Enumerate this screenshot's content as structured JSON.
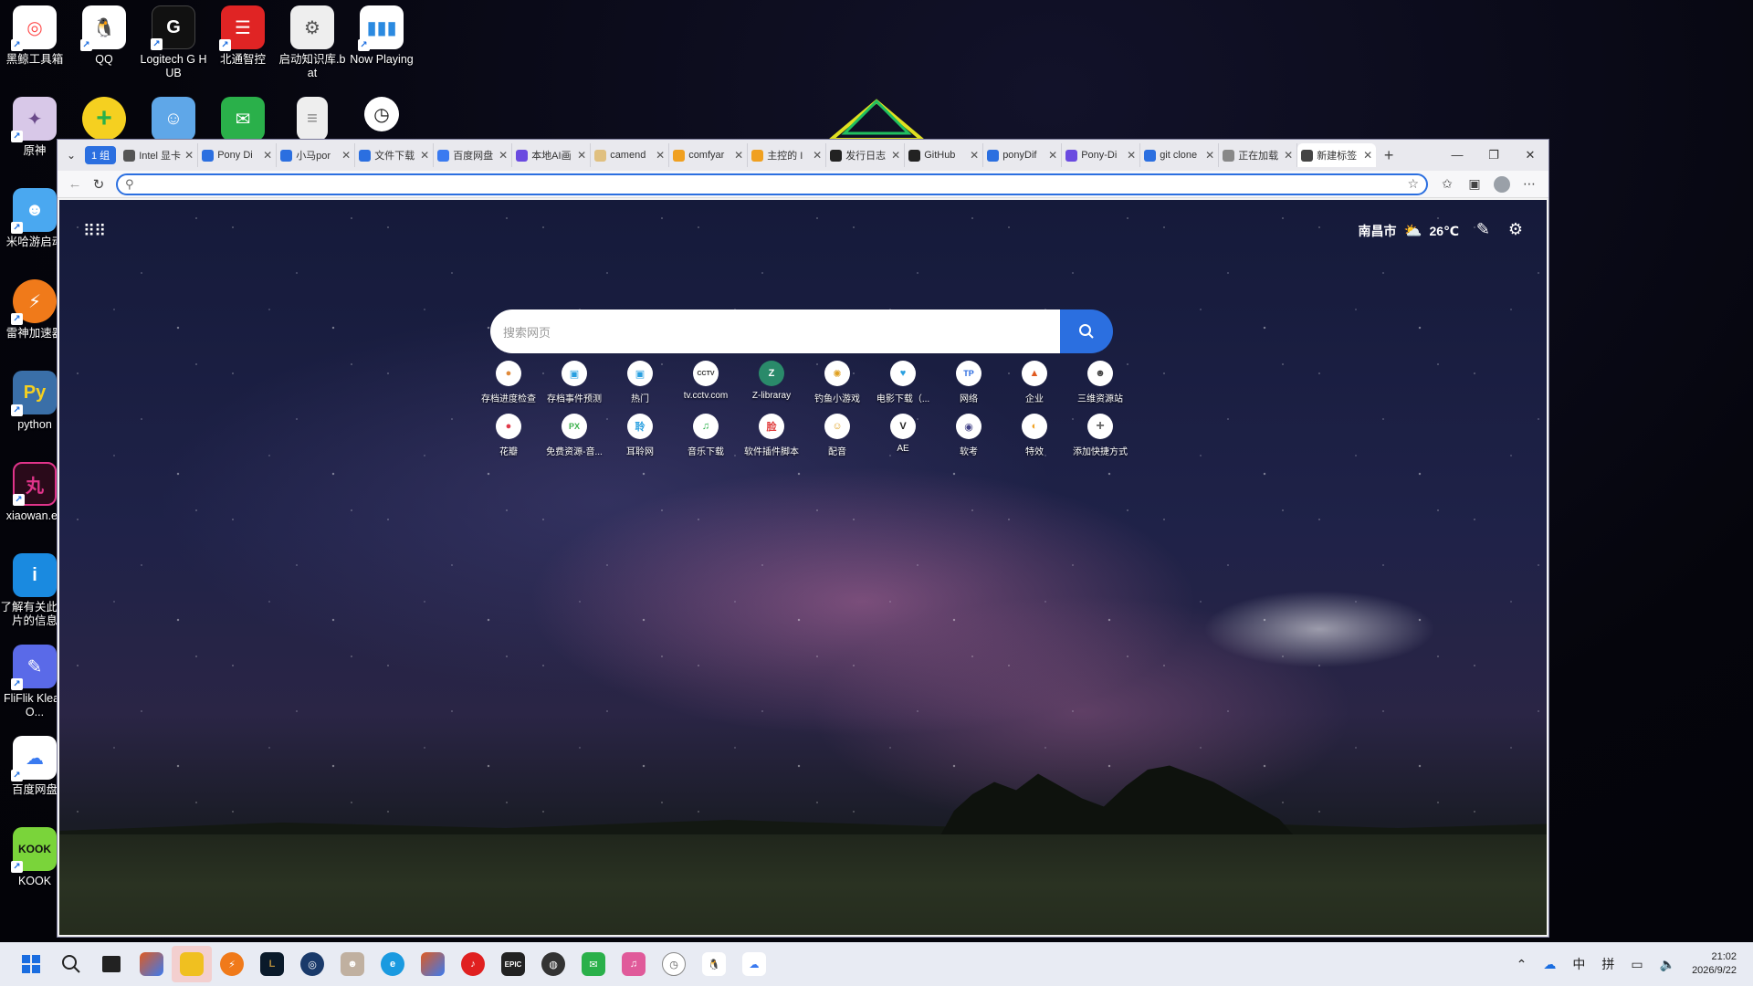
{
  "desktop": {
    "icons_top": [
      {
        "label": "黑鲸工具箱",
        "icon": "heijing-icon",
        "color": "#ff4d4d"
      },
      {
        "label": "QQ",
        "icon": "qq-icon",
        "color": "#ffffff"
      },
      {
        "label": "Logitech G HUB",
        "icon": "logitech-g-icon",
        "color": "#111111"
      },
      {
        "label": "北通智控",
        "icon": "beitong-icon",
        "color": "#e02424"
      },
      {
        "label": "启动知识库.bat",
        "icon": "bat-file-icon",
        "color": "#eeeeee"
      },
      {
        "label": "Now Playing",
        "icon": "now-playing-icon",
        "color": "#ffffff"
      }
    ],
    "icons_second_row": [
      {
        "icon": "plus-green-icon",
        "color": "#2ab04a"
      },
      {
        "icon": "chat-blue-icon",
        "color": "#5fa7e8"
      },
      {
        "icon": "wechat-icon",
        "color": "#2ab04a"
      },
      {
        "icon": "document-icon",
        "color": "#eeeeee"
      },
      {
        "icon": "clock-icon",
        "color": "#ffffff"
      }
    ],
    "icons_left": [
      {
        "label": "原神",
        "icon": "genshin-icon",
        "color": "#d8c8e8"
      },
      {
        "label": "米哈游启动",
        "icon": "mihoyo-launcher-icon",
        "color": "#4aa8f0"
      },
      {
        "label": "雷神加速器",
        "icon": "leishen-icon",
        "color": "#f07a1a"
      },
      {
        "label": "python",
        "icon": "python-icon",
        "color": "#3a6fa8"
      },
      {
        "label": "xiaowan.ex",
        "icon": "xiaowan-icon",
        "color": "#e0348a"
      },
      {
        "label": "了解有关此图片的信息",
        "icon": "spotlight-info-icon",
        "color": "#1a8ae0"
      },
      {
        "label": "FliFlik KleanO...",
        "icon": "fliflik-icon",
        "color": "#5a6ae8"
      },
      {
        "label": "百度网盘",
        "icon": "baidu-netdisk-icon",
        "color": "#ffffff"
      },
      {
        "label": "KOOK",
        "icon": "kook-icon",
        "color": "#7ad43a"
      }
    ]
  },
  "browser": {
    "tab_group_label": "1 组",
    "tabs": [
      {
        "title": "Intel 显卡",
        "icon": "page-icon",
        "color": "#555555"
      },
      {
        "title": "Pony Di",
        "icon": "edge-icon",
        "color": "#2b6fe0"
      },
      {
        "title": "小马por",
        "icon": "edge-icon",
        "color": "#2b6fe0"
      },
      {
        "title": "文件下载",
        "icon": "edge-icon",
        "color": "#2b6fe0"
      },
      {
        "title": "百度网盘",
        "icon": "baidu-icon",
        "color": "#3a7af0"
      },
      {
        "title": "本地AI画",
        "icon": "ai-icon",
        "color": "#6a4ae0"
      },
      {
        "title": "camend",
        "icon": "page-icon",
        "color": "#e0c080"
      },
      {
        "title": "comfyar",
        "icon": "page-icon",
        "color": "#f0a020"
      },
      {
        "title": "主控的 I",
        "icon": "page-icon",
        "color": "#f0a020"
      },
      {
        "title": "发行日志",
        "icon": "github-icon",
        "color": "#222222"
      },
      {
        "title": "GitHub",
        "icon": "github-icon",
        "color": "#222222"
      },
      {
        "title": "ponyDif",
        "icon": "search-icon",
        "color": "#2b6fe0"
      },
      {
        "title": "Pony-Di",
        "icon": "page-icon",
        "color": "#6a4ae0"
      },
      {
        "title": "git clone",
        "icon": "search-icon",
        "color": "#2b6fe0"
      },
      {
        "title": "正在加载",
        "icon": "loading-icon",
        "color": "#888888"
      },
      {
        "title": "新建标签",
        "icon": "newtab-icon",
        "color": "#444444"
      }
    ],
    "url_placeholder": ""
  },
  "ntp": {
    "location": "南昌市",
    "temperature": "26℃",
    "search_placeholder": "搜索网页",
    "shortcuts_row1": [
      {
        "label": "存档进度检查",
        "color": "#e08a3a"
      },
      {
        "label": "存档事件预测",
        "color": "#2aa0e0"
      },
      {
        "label": "热门",
        "color": "#2aa0e0"
      },
      {
        "label": "tv.cctv.com",
        "color": "#333333"
      },
      {
        "label": "Z-libraray",
        "color": "#2a8a6a"
      },
      {
        "label": "钓鱼小游戏",
        "color": "#e0a020"
      },
      {
        "label": "电影下载（...",
        "color": "#2aa0e0"
      },
      {
        "label": "网络",
        "color": "#2a6ae0"
      },
      {
        "label": "企业",
        "color": "#e05a20"
      },
      {
        "label": "三维资源站",
        "color": "#444444"
      }
    ],
    "shortcuts_row2": [
      {
        "label": "花瓣",
        "color": "#e03a4a"
      },
      {
        "label": "免费资源-音...",
        "color": "#3ab04a"
      },
      {
        "label": "耳聆网",
        "color": "#2aa0e0"
      },
      {
        "label": "音乐下载",
        "color": "#2ab04a"
      },
      {
        "label": "软件插件脚本",
        "color": "#e03a3a"
      },
      {
        "label": "配音",
        "color": "#e0a020"
      },
      {
        "label": "AE",
        "color": "#222222"
      },
      {
        "label": "软考",
        "color": "#444488"
      },
      {
        "label": "特效",
        "color": "#f0a020"
      },
      {
        "label": "添加快捷方式",
        "color": "#666666"
      }
    ]
  },
  "taskbar": {
    "icons": [
      {
        "icon": "windows-start-icon",
        "color": "#1a6de0"
      },
      {
        "icon": "search-icon",
        "color": "#222222"
      },
      {
        "icon": "task-view-icon",
        "color": "#222222"
      },
      {
        "icon": "widgets-icon",
        "color": "#e05a20"
      },
      {
        "icon": "file-explorer-icon",
        "color": "#f0c020"
      },
      {
        "icon": "leishen-icon",
        "color": "#f07a1a"
      },
      {
        "icon": "league-icon",
        "color": "#b08a3a"
      },
      {
        "icon": "steam-icon",
        "color": "#1a3a6a"
      },
      {
        "icon": "game-icon",
        "color": "#c0b0a0"
      },
      {
        "icon": "edge-icon",
        "color": "#1a9ae0"
      },
      {
        "icon": "pinned-app-icon",
        "color": "#e05a20"
      },
      {
        "icon": "netease-music-icon",
        "color": "#e02020"
      },
      {
        "icon": "epic-games-icon",
        "color": "#222222"
      },
      {
        "icon": "obs-icon",
        "color": "#333333"
      },
      {
        "icon": "wechat-icon",
        "color": "#2ab04a"
      },
      {
        "icon": "pink-app-icon",
        "color": "#e05a9a"
      },
      {
        "icon": "clock-app-icon",
        "color": "#555555"
      },
      {
        "icon": "qq-icon",
        "color": "#222222"
      },
      {
        "icon": "baidu-netdisk-icon",
        "color": "#3a7af0"
      }
    ],
    "ime_lang": "中",
    "ime_mode": "拼",
    "time": "21:02",
    "date": "2026/9/22"
  }
}
